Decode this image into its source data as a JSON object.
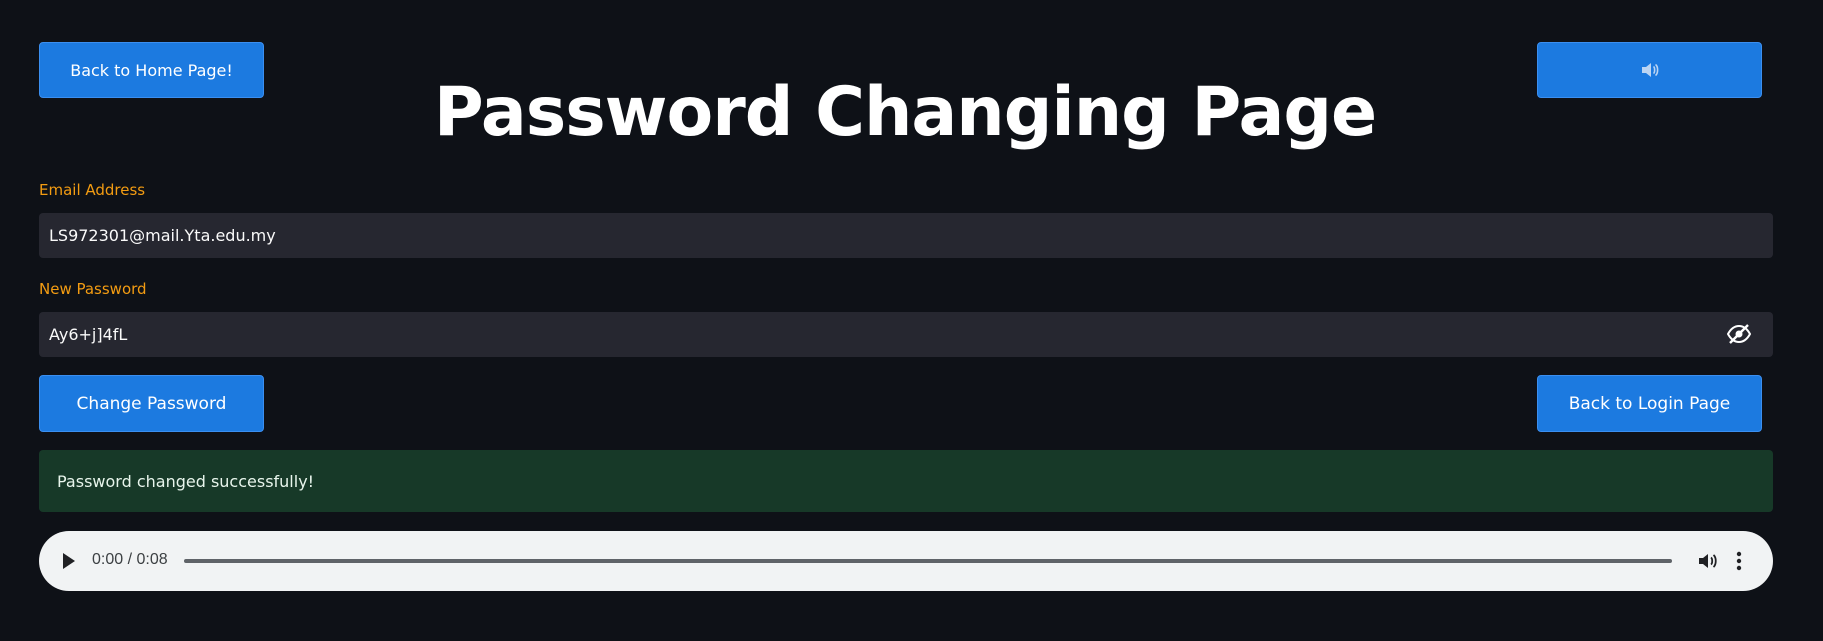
{
  "header": {
    "home_button_label": "Back to Home Page!",
    "title": "Password Changing Page",
    "sound_button_icon": "speaker-icon"
  },
  "form": {
    "email_label": "Email Address",
    "email_value": "LS972301@mail.Yta.edu.my",
    "password_label": "New Password",
    "password_value": "Ay6+j]4fL",
    "password_toggle_icon": "eye-slash-icon"
  },
  "actions": {
    "change_label": "Change Password",
    "login_label": "Back to Login Page"
  },
  "alert": {
    "message": "Password changed successfully!"
  },
  "audio": {
    "time_display": "0:00 / 0:08",
    "progress": 0
  },
  "colors": {
    "background": "#0e1117",
    "button": "#1c7ae0",
    "label": "#f39c12",
    "input_bg": "#262730",
    "success_bg": "#173928"
  }
}
